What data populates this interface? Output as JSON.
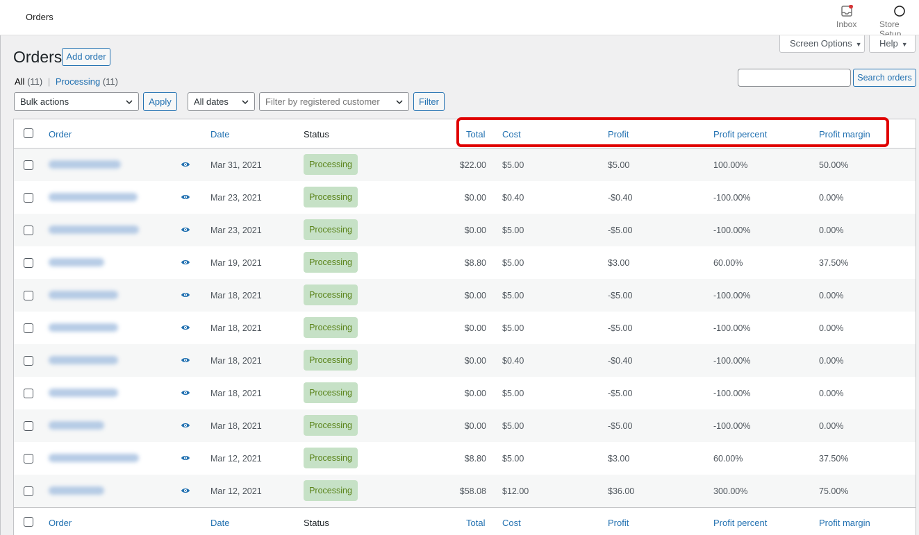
{
  "topbar": {
    "title": "Orders",
    "inbox_label": "Inbox",
    "store_setup_label": "Store Setup"
  },
  "tabs": {
    "screen_options": "Screen Options",
    "help": "Help"
  },
  "page": {
    "title": "Orders",
    "add_order": "Add order"
  },
  "views": {
    "all_label": "All",
    "all_count": "(11)",
    "separator": "|",
    "processing_label": "Processing",
    "processing_count": "(11)"
  },
  "search": {
    "value": "",
    "button": "Search orders"
  },
  "filters": {
    "bulk_actions": "Bulk actions",
    "apply": "Apply",
    "dates": "All dates",
    "customer_placeholder": "Filter by registered customer",
    "filter": "Filter"
  },
  "columns": {
    "order": "Order",
    "date": "Date",
    "status": "Status",
    "total": "Total",
    "cost": "Cost",
    "profit": "Profit",
    "profit_percent": "Profit percent",
    "profit_margin": "Profit margin"
  },
  "orders": [
    {
      "date": "Mar 31, 2021",
      "status": "Processing",
      "total": "$22.00",
      "cost": "$5.00",
      "profit": "$5.00",
      "profit_percent": "100.00%",
      "profit_margin": "50.00%"
    },
    {
      "date": "Mar 23, 2021",
      "status": "Processing",
      "total": "$0.00",
      "cost": "$0.40",
      "profit": "-$0.40",
      "profit_percent": "-100.00%",
      "profit_margin": "0.00%"
    },
    {
      "date": "Mar 23, 2021",
      "status": "Processing",
      "total": "$0.00",
      "cost": "$5.00",
      "profit": "-$5.00",
      "profit_percent": "-100.00%",
      "profit_margin": "0.00%"
    },
    {
      "date": "Mar 19, 2021",
      "status": "Processing",
      "total": "$8.80",
      "cost": "$5.00",
      "profit": "$3.00",
      "profit_percent": "60.00%",
      "profit_margin": "37.50%"
    },
    {
      "date": "Mar 18, 2021",
      "status": "Processing",
      "total": "$0.00",
      "cost": "$5.00",
      "profit": "-$5.00",
      "profit_percent": "-100.00%",
      "profit_margin": "0.00%"
    },
    {
      "date": "Mar 18, 2021",
      "status": "Processing",
      "total": "$0.00",
      "cost": "$5.00",
      "profit": "-$5.00",
      "profit_percent": "-100.00%",
      "profit_margin": "0.00%"
    },
    {
      "date": "Mar 18, 2021",
      "status": "Processing",
      "total": "$0.00",
      "cost": "$0.40",
      "profit": "-$0.40",
      "profit_percent": "-100.00%",
      "profit_margin": "0.00%"
    },
    {
      "date": "Mar 18, 2021",
      "status": "Processing",
      "total": "$0.00",
      "cost": "$5.00",
      "profit": "-$5.00",
      "profit_percent": "-100.00%",
      "profit_margin": "0.00%"
    },
    {
      "date": "Mar 18, 2021",
      "status": "Processing",
      "total": "$0.00",
      "cost": "$5.00",
      "profit": "-$5.00",
      "profit_percent": "-100.00%",
      "profit_margin": "0.00%"
    },
    {
      "date": "Mar 12, 2021",
      "status": "Processing",
      "total": "$8.80",
      "cost": "$5.00",
      "profit": "$3.00",
      "profit_percent": "60.00%",
      "profit_margin": "37.50%"
    },
    {
      "date": "Mar 12, 2021",
      "status": "Processing",
      "total": "$58.08",
      "cost": "$12.00",
      "profit": "$36.00",
      "profit_percent": "300.00%",
      "profit_margin": "75.00%"
    }
  ],
  "colors": {
    "link": "#2271b1",
    "status_processing_bg": "#c6e1c6",
    "status_processing_text": "#5b841b",
    "highlight": "#e00000"
  },
  "icons": [
    "inbox-icon",
    "store-setup-icon",
    "chevron-down-icon",
    "eye-icon"
  ]
}
